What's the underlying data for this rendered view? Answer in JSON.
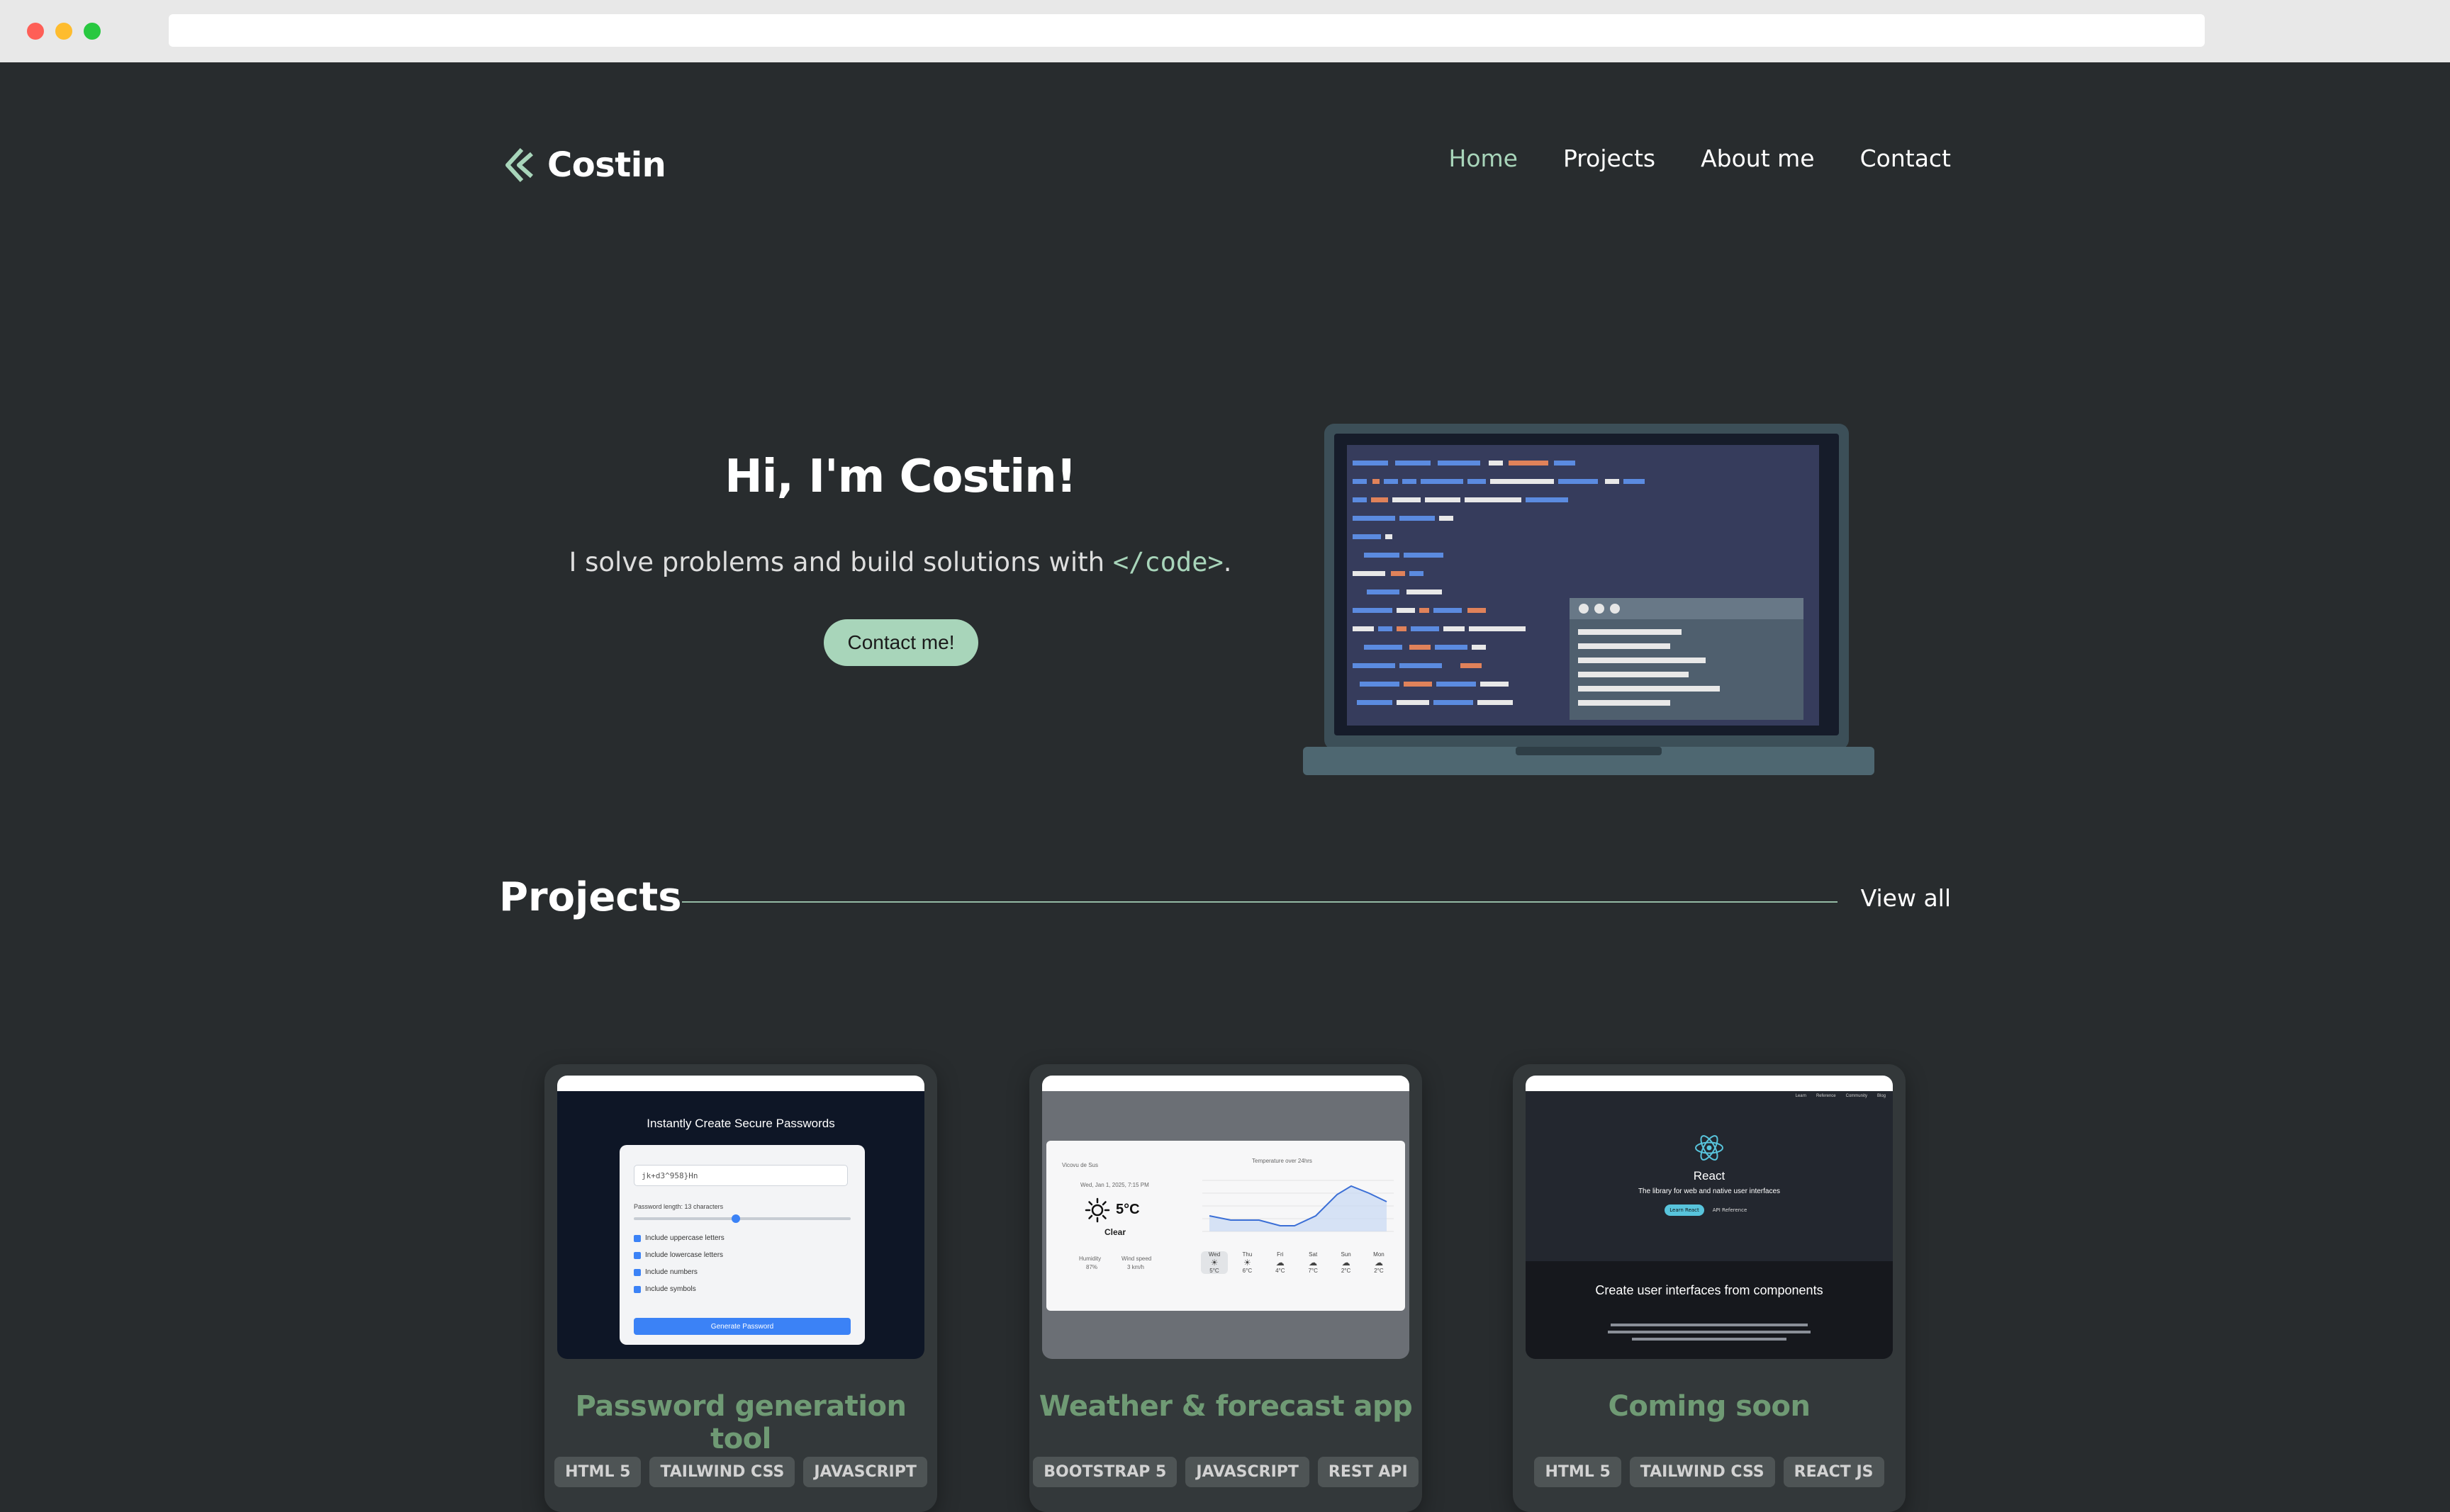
{
  "brand": {
    "name": "Costin"
  },
  "nav": {
    "items": [
      "Home",
      "Projects",
      "About me",
      "Contact"
    ],
    "active": "Home"
  },
  "hero": {
    "title": "Hi, I'm Costin!",
    "subtitle_prefix": "I solve problems and build solutions with ",
    "subtitle_code": "</code>",
    "subtitle_suffix": ".",
    "cta": "Contact me!"
  },
  "projects": {
    "title": "Projects",
    "view_all": "View all",
    "cards": [
      {
        "title": "Password generation tool",
        "tags": [
          "HTML 5",
          "TAILWIND CSS",
          "JAVASCRIPT"
        ]
      },
      {
        "title": "Weather & forecast app",
        "tags": [
          "BOOTSTRAP 5",
          "JAVASCRIPT",
          "REST API"
        ]
      },
      {
        "title": "Coming soon",
        "tags": [
          "HTML 5",
          "TAILWIND CSS",
          "REACT JS"
        ]
      }
    ]
  },
  "thumb_password": {
    "title": "Instantly Create Secure Passwords",
    "password": "jk+d3^958}Hn",
    "length_label": "Password length: 13 characters",
    "options": [
      "Include uppercase letters",
      "Include lowercase letters",
      "Include numbers",
      "Include symbols"
    ],
    "button": "Generate Password"
  },
  "thumb_weather": {
    "location": "Vicovu de Sus",
    "date": "Wed, Jan 1, 2025, 7:15 PM",
    "temp": "5°C",
    "condition": "Clear",
    "humidity_label": "Humidity",
    "humidity": "87%",
    "wind_label": "Wind speed",
    "wind": "3 km/h",
    "chart_title": "Temperature over 24hrs",
    "days": [
      {
        "day": "Wed",
        "temp": "5°C"
      },
      {
        "day": "Thu",
        "temp": "6°C"
      },
      {
        "day": "Fri",
        "temp": "4°C"
      },
      {
        "day": "Sat",
        "temp": "7°C"
      },
      {
        "day": "Sun",
        "temp": "2°C"
      },
      {
        "day": "Mon",
        "temp": "2°C"
      }
    ]
  },
  "thumb_react": {
    "name": "React",
    "tagline": "The library for web and native user interfaces",
    "btn_primary": "Learn React",
    "btn_secondary": "API Reference",
    "nav": [
      "Learn",
      "Reference",
      "Community",
      "Blog"
    ],
    "heading": "Create user interfaces from components"
  },
  "colors": {
    "accent": "#a8d5ba",
    "card_title": "#6f9a74",
    "background": "#282c2e"
  }
}
